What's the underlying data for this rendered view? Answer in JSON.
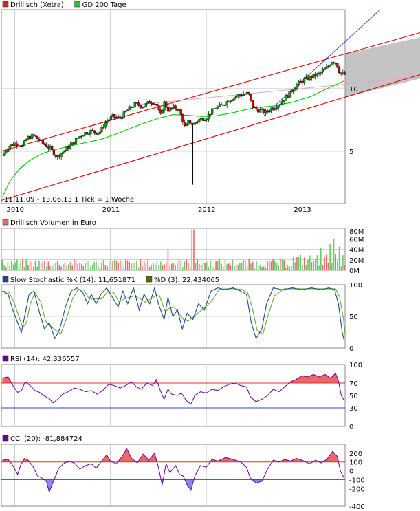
{
  "colors": {
    "price": "#000000",
    "up": "#00aa00",
    "down": "#cc0000",
    "sma": "#00cc00",
    "channel": "#dd0000",
    "trend_blue": "#3344cc",
    "trend_pink": "#e8a0c8",
    "forecast_fill": "#c4c4c4",
    "grid": "#aaaaaa",
    "volume_up": "#66cc66",
    "volume_down": "#ee6666",
    "stoch_k": "#1a4a8a",
    "stoch_d": "#66aa33",
    "rsi_line": "#660099",
    "over_fill": "#ee6666",
    "under_fill": "#8888ee",
    "ref_red": "#dd3333",
    "ref_blue": "#3344cc"
  },
  "chart_data": [
    {
      "type": "candlestick",
      "panel": "price",
      "legend": [
        {
          "label": "Drillisch (Xetra)",
          "icon": "red-square",
          "color": "#dd2222"
        },
        {
          "label": "GD 200 Tage",
          "icon": "green-square",
          "color": "#22cc22"
        }
      ],
      "range_label": "11.11.09 - 13.06.13",
      "tick_label": "1 Tick = 1 Woche",
      "x_tick_labels": [
        "2010",
        "2011",
        "2012",
        "2013"
      ],
      "x_tick_dates": [
        2010.0,
        2011.0,
        2012.0,
        2013.0
      ],
      "xlim": [
        2009.86,
        2013.45
      ],
      "y_scale": "log",
      "y_tick_labels": [
        "10",
        "5"
      ],
      "y_tick_values": [
        10,
        5
      ],
      "ylim": [
        2.8,
        24
      ],
      "close_points": [
        [
          2009.87,
          4.75
        ],
        [
          2009.95,
          5.35
        ],
        [
          2010.03,
          5.45
        ],
        [
          2010.08,
          5.25
        ],
        [
          2010.13,
          5.8
        ],
        [
          2010.2,
          5.95
        ],
        [
          2010.28,
          5.5
        ],
        [
          2010.36,
          5.2
        ],
        [
          2010.44,
          4.7
        ],
        [
          2010.5,
          4.95
        ],
        [
          2010.58,
          5.3
        ],
        [
          2010.64,
          5.7
        ],
        [
          2010.72,
          6.1
        ],
        [
          2010.8,
          6.25
        ],
        [
          2010.88,
          6.1
        ],
        [
          2010.95,
          6.9
        ],
        [
          2011.02,
          7.35
        ],
        [
          2011.1,
          7.2
        ],
        [
          2011.18,
          7.9
        ],
        [
          2011.26,
          8.45
        ],
        [
          2011.34,
          8.2
        ],
        [
          2011.42,
          8.7
        ],
        [
          2011.48,
          8.45
        ],
        [
          2011.52,
          7.3
        ],
        [
          2011.56,
          8.6
        ],
        [
          2011.6,
          7.9
        ],
        [
          2011.66,
          8.1
        ],
        [
          2011.72,
          7.85
        ],
        [
          2011.78,
          6.4
        ],
        [
          2011.82,
          7.0
        ],
        [
          2011.86,
          6.7
        ],
        [
          2011.92,
          7.1
        ],
        [
          2012.0,
          7.25
        ],
        [
          2012.08,
          8.0
        ],
        [
          2012.16,
          8.3
        ],
        [
          2012.24,
          8.8
        ],
        [
          2012.32,
          9.25
        ],
        [
          2012.38,
          9.4
        ],
        [
          2012.44,
          9.5
        ],
        [
          2012.48,
          8.2
        ],
        [
          2012.54,
          7.9
        ],
        [
          2012.62,
          7.7
        ],
        [
          2012.7,
          8.1
        ],
        [
          2012.78,
          8.6
        ],
        [
          2012.86,
          9.4
        ],
        [
          2012.94,
          10.4
        ],
        [
          2013.02,
          11.0
        ],
        [
          2013.1,
          11.4
        ],
        [
          2013.18,
          11.8
        ],
        [
          2013.26,
          12.6
        ],
        [
          2013.32,
          13.7
        ],
        [
          2013.36,
          13.2
        ],
        [
          2013.4,
          11.8
        ],
        [
          2013.44,
          11.7
        ]
      ],
      "extreme_low": {
        "x": 2011.86,
        "y": 3.45
      },
      "sma200_points": [
        [
          2009.87,
          3.0
        ],
        [
          2009.95,
          3.6
        ],
        [
          2010.05,
          4.1
        ],
        [
          2010.15,
          4.5
        ],
        [
          2010.3,
          4.9
        ],
        [
          2010.5,
          5.2
        ],
        [
          2010.7,
          5.45
        ],
        [
          2010.9,
          5.7
        ],
        [
          2011.1,
          6.15
        ],
        [
          2011.3,
          6.7
        ],
        [
          2011.5,
          7.2
        ],
        [
          2011.65,
          7.5
        ],
        [
          2011.8,
          7.45
        ],
        [
          2011.95,
          7.35
        ],
        [
          2012.1,
          7.4
        ],
        [
          2012.3,
          7.7
        ],
        [
          2012.5,
          8.1
        ],
        [
          2012.7,
          8.25
        ],
        [
          2012.9,
          8.6
        ],
        [
          2013.1,
          9.2
        ],
        [
          2013.3,
          10.2
        ],
        [
          2013.44,
          10.9
        ]
      ],
      "channel_upper": [
        [
          2009.86,
          5.0
        ],
        [
          2013.45,
          14.7
        ]
      ],
      "channel_lower": [
        [
          2009.86,
          2.9
        ],
        [
          2013.45,
          9.1
        ]
      ],
      "channel_extension": {
        "upper": [
          [
            2013.45,
            14.7
          ],
          [
            2013.9,
            16.4
          ]
        ],
        "lower": [
          [
            2013.45,
            9.1
          ],
          [
            2013.9,
            10.3
          ]
        ]
      },
      "trend_blue": [
        [
          2012.6,
          7.4
        ],
        [
          2013.9,
          26.0
        ]
      ],
      "trend_pink": [
        [
          2011.3,
          8.4
        ],
        [
          2013.9,
          11.0
        ]
      ]
    },
    {
      "type": "bar",
      "panel": "volume",
      "legend": [
        {
          "label": "Drillisch Volumen in Euro",
          "color": "#ee6666"
        }
      ],
      "y_tick_labels": [
        "80M",
        "60M",
        "40M",
        "20M",
        "0M"
      ],
      "y_tick_values": [
        80,
        60,
        40,
        20,
        0
      ],
      "ylim": [
        0,
        80
      ],
      "unit": "M",
      "spikes": [
        [
          2011.86,
          78
        ],
        [
          2013.34,
          60
        ],
        [
          2013.3,
          50
        ],
        [
          2013.2,
          42
        ],
        [
          2013.38,
          45
        ],
        [
          2011.6,
          40
        ]
      ],
      "baseline_range": [
        5,
        22
      ]
    },
    {
      "type": "line",
      "panel": "stochastic",
      "legend": [
        {
          "label": "Slow Stochastic %K (14): 11,651871",
          "color": "#1a4a8a"
        },
        {
          "label": "%D (3): 22,434065",
          "color": "#666600"
        }
      ],
      "y_tick_labels": [
        "100",
        "50",
        "0"
      ],
      "y_tick_values": [
        100,
        50,
        0
      ],
      "ylim": [
        0,
        100
      ],
      "k_points": [
        [
          2009.87,
          90
        ],
        [
          2009.93,
          85
        ],
        [
          2009.98,
          60
        ],
        [
          2010.03,
          40
        ],
        [
          2010.07,
          25
        ],
        [
          2010.11,
          55
        ],
        [
          2010.15,
          85
        ],
        [
          2010.2,
          90
        ],
        [
          2010.26,
          55
        ],
        [
          2010.31,
          30
        ],
        [
          2010.36,
          40
        ],
        [
          2010.42,
          15
        ],
        [
          2010.47,
          30
        ],
        [
          2010.53,
          65
        ],
        [
          2010.59,
          90
        ],
        [
          2010.65,
          95
        ],
        [
          2010.71,
          88
        ],
        [
          2010.76,
          70
        ],
        [
          2010.8,
          85
        ],
        [
          2010.85,
          70
        ],
        [
          2010.9,
          85
        ],
        [
          2010.96,
          95
        ],
        [
          2011.02,
          80
        ],
        [
          2011.08,
          65
        ],
        [
          2011.13,
          90
        ],
        [
          2011.18,
          70
        ],
        [
          2011.24,
          95
        ],
        [
          2011.3,
          60
        ],
        [
          2011.35,
          85
        ],
        [
          2011.41,
          70
        ],
        [
          2011.46,
          95
        ],
        [
          2011.5,
          70
        ],
        [
          2011.56,
          45
        ],
        [
          2011.6,
          80
        ],
        [
          2011.65,
          50
        ],
        [
          2011.7,
          60
        ],
        [
          2011.75,
          30
        ],
        [
          2011.8,
          55
        ],
        [
          2011.86,
          45
        ],
        [
          2011.92,
          70
        ],
        [
          2011.98,
          60
        ],
        [
          2012.05,
          90
        ],
        [
          2012.12,
          95
        ],
        [
          2012.2,
          92
        ],
        [
          2012.28,
          95
        ],
        [
          2012.36,
          90
        ],
        [
          2012.42,
          85
        ],
        [
          2012.47,
          40
        ],
        [
          2012.52,
          15
        ],
        [
          2012.58,
          30
        ],
        [
          2012.63,
          70
        ],
        [
          2012.7,
          95
        ],
        [
          2012.8,
          92
        ],
        [
          2012.9,
          95
        ],
        [
          2013.0,
          92
        ],
        [
          2013.1,
          95
        ],
        [
          2013.2,
          92
        ],
        [
          2013.28,
          95
        ],
        [
          2013.34,
          92
        ],
        [
          2013.38,
          70
        ],
        [
          2013.42,
          25
        ],
        [
          2013.44,
          12
        ]
      ],
      "k_value_label": "11,651871",
      "d_value_label": "22,434065"
    },
    {
      "type": "line",
      "panel": "rsi",
      "legend": [
        {
          "label": "RSI (14): 42,336557",
          "color": "#660099"
        }
      ],
      "y_tick_labels": [
        "100",
        "70",
        "50",
        "30",
        "0"
      ],
      "y_tick_values": [
        100,
        70,
        50,
        30,
        0
      ],
      "ylim": [
        0,
        100
      ],
      "reference_lines": [
        70,
        30
      ],
      "points": [
        [
          2009.87,
          78
        ],
        [
          2009.93,
          80
        ],
        [
          2009.98,
          66
        ],
        [
          2010.03,
          55
        ],
        [
          2010.07,
          58
        ],
        [
          2010.11,
          72
        ],
        [
          2010.16,
          66
        ],
        [
          2010.21,
          58
        ],
        [
          2010.26,
          55
        ],
        [
          2010.3,
          50
        ],
        [
          2010.36,
          45
        ],
        [
          2010.4,
          38
        ],
        [
          2010.45,
          44
        ],
        [
          2010.5,
          52
        ],
        [
          2010.56,
          56
        ],
        [
          2010.62,
          62
        ],
        [
          2010.68,
          60
        ],
        [
          2010.74,
          56
        ],
        [
          2010.8,
          58
        ],
        [
          2010.86,
          52
        ],
        [
          2010.92,
          58
        ],
        [
          2010.98,
          68
        ],
        [
          2011.04,
          66
        ],
        [
          2011.1,
          62
        ],
        [
          2011.16,
          66
        ],
        [
          2011.22,
          72
        ],
        [
          2011.27,
          64
        ],
        [
          2011.32,
          60
        ],
        [
          2011.38,
          70
        ],
        [
          2011.44,
          66
        ],
        [
          2011.48,
          76
        ],
        [
          2011.52,
          58
        ],
        [
          2011.56,
          44
        ],
        [
          2011.6,
          60
        ],
        [
          2011.64,
          52
        ],
        [
          2011.7,
          50
        ],
        [
          2011.74,
          54
        ],
        [
          2011.79,
          42
        ],
        [
          2011.84,
          36
        ],
        [
          2011.88,
          50
        ],
        [
          2011.94,
          56
        ],
        [
          2012.0,
          54
        ],
        [
          2012.06,
          60
        ],
        [
          2012.12,
          58
        ],
        [
          2012.18,
          64
        ],
        [
          2012.24,
          68
        ],
        [
          2012.3,
          70
        ],
        [
          2012.36,
          66
        ],
        [
          2012.42,
          64
        ],
        [
          2012.46,
          48
        ],
        [
          2012.52,
          40
        ],
        [
          2012.58,
          44
        ],
        [
          2012.64,
          50
        ],
        [
          2012.7,
          60
        ],
        [
          2012.76,
          56
        ],
        [
          2012.82,
          64
        ],
        [
          2012.88,
          72
        ],
        [
          2012.94,
          76
        ],
        [
          2013.0,
          82
        ],
        [
          2013.06,
          80
        ],
        [
          2013.12,
          84
        ],
        [
          2013.18,
          80
        ],
        [
          2013.24,
          84
        ],
        [
          2013.3,
          78
        ],
        [
          2013.35,
          86
        ],
        [
          2013.38,
          74
        ],
        [
          2013.41,
          50
        ],
        [
          2013.44,
          42
        ]
      ]
    },
    {
      "type": "line",
      "panel": "cci",
      "legend": [
        {
          "label": "CCI (20): -81,884724",
          "color": "#660099"
        }
      ],
      "y_tick_labels": [
        "200",
        "100",
        "0",
        "-100",
        "-200",
        "-400"
      ],
      "y_tick_values": [
        200,
        100,
        0,
        -100,
        -200,
        -400
      ],
      "ylim": [
        -400,
        300
      ],
      "reference_lines": [
        100,
        -100
      ],
      "points": [
        [
          2009.87,
          120
        ],
        [
          2009.93,
          130
        ],
        [
          2009.98,
          60
        ],
        [
          2010.03,
          -40
        ],
        [
          2010.06,
          60
        ],
        [
          2010.1,
          140
        ],
        [
          2010.14,
          120
        ],
        [
          2010.19,
          50
        ],
        [
          2010.24,
          -60
        ],
        [
          2010.28,
          -80
        ],
        [
          2010.33,
          -120
        ],
        [
          2010.36,
          -240
        ],
        [
          2010.4,
          -130
        ],
        [
          2010.46,
          30
        ],
        [
          2010.52,
          90
        ],
        [
          2010.58,
          110
        ],
        [
          2010.63,
          80
        ],
        [
          2010.68,
          20
        ],
        [
          2010.74,
          60
        ],
        [
          2010.8,
          80
        ],
        [
          2010.85,
          30
        ],
        [
          2010.9,
          100
        ],
        [
          2010.96,
          180
        ],
        [
          2011.0,
          110
        ],
        [
          2011.06,
          80
        ],
        [
          2011.12,
          160
        ],
        [
          2011.17,
          250
        ],
        [
          2011.22,
          140
        ],
        [
          2011.28,
          90
        ],
        [
          2011.34,
          190
        ],
        [
          2011.4,
          120
        ],
        [
          2011.46,
          200
        ],
        [
          2011.5,
          40
        ],
        [
          2011.54,
          -160
        ],
        [
          2011.58,
          80
        ],
        [
          2011.62,
          -20
        ],
        [
          2011.68,
          60
        ],
        [
          2011.72,
          -40
        ],
        [
          2011.76,
          -60
        ],
        [
          2011.8,
          -160
        ],
        [
          2011.84,
          -220
        ],
        [
          2011.88,
          -60
        ],
        [
          2011.94,
          60
        ],
        [
          2012.0,
          40
        ],
        [
          2012.06,
          130
        ],
        [
          2012.12,
          110
        ],
        [
          2012.2,
          150
        ],
        [
          2012.28,
          130
        ],
        [
          2012.36,
          100
        ],
        [
          2012.42,
          40
        ],
        [
          2012.46,
          -80
        ],
        [
          2012.52,
          -140
        ],
        [
          2012.58,
          -120
        ],
        [
          2012.64,
          20
        ],
        [
          2012.7,
          120
        ],
        [
          2012.76,
          100
        ],
        [
          2012.82,
          130
        ],
        [
          2012.88,
          110
        ],
        [
          2012.94,
          140
        ],
        [
          2013.0,
          120
        ],
        [
          2013.08,
          80
        ],
        [
          2013.14,
          120
        ],
        [
          2013.2,
          90
        ],
        [
          2013.26,
          130
        ],
        [
          2013.32,
          220
        ],
        [
          2013.37,
          160
        ],
        [
          2013.4,
          0
        ],
        [
          2013.44,
          -82
        ]
      ]
    }
  ]
}
